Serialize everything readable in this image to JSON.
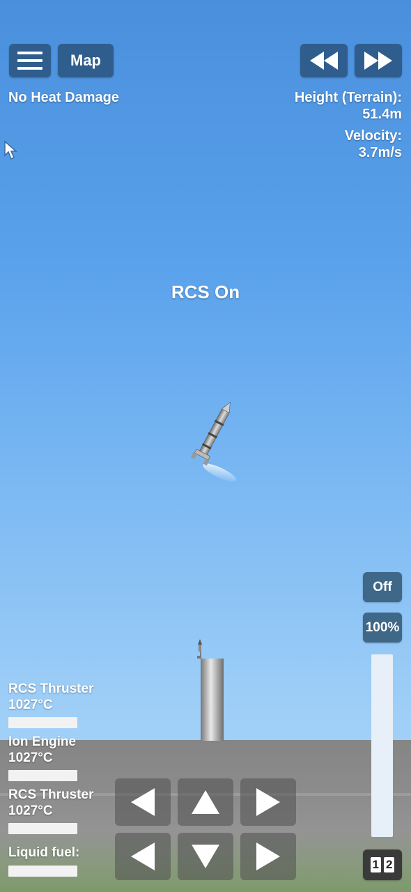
{
  "toolbar": {
    "menu_icon": "hamburger-menu-icon",
    "map_label": "Map",
    "rewind_icon": "rewind-icon",
    "fastforward_icon": "fast-forward-icon"
  },
  "status": {
    "heat_damage": "No Heat Damage",
    "height_label": "Height (Terrain):",
    "height_value": "51.4m",
    "velocity_label": "Velocity:",
    "velocity_value": "3.7m/s",
    "rcs_message": "RCS On"
  },
  "parts": [
    {
      "name": "RCS Thruster",
      "temp": "1027°C"
    },
    {
      "name": "Ion Engine",
      "temp": "1027°C"
    },
    {
      "name": "RCS Thruster",
      "temp": "1027°C"
    }
  ],
  "fuel": {
    "label": "Liquid fuel:"
  },
  "controls": {
    "off_label": "Off",
    "throttle_label": "100%",
    "throttle_level": 1.0,
    "stage_digit_1": "1",
    "stage_digit_2": "2"
  },
  "colors": {
    "button_bg": "#2f5e8e",
    "sky_top": "#4a8fdc",
    "sky_bottom": "#a9d3f7",
    "ground": "#8c8c8c"
  }
}
